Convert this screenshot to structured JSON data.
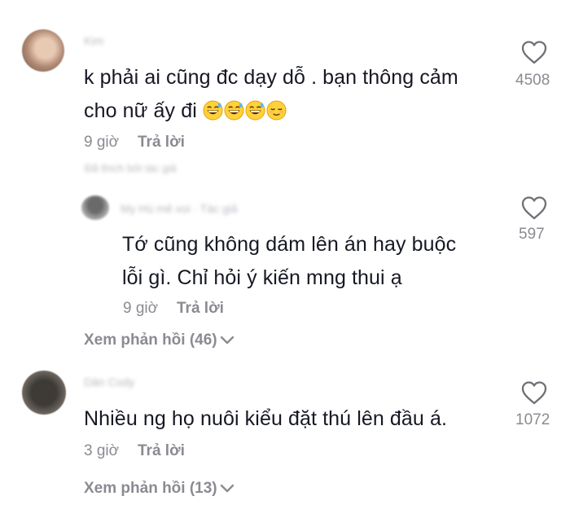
{
  "comments": [
    {
      "username": "Kim",
      "text_line1": "k phải ai cũng đc dạy dỗ . bạn thông cảm",
      "text_line2": "cho nữ ấy đi",
      "emojis": [
        "grinning-sweat-face",
        "grinning-sweat-face",
        "grinning-sweat-face",
        "relieved-face"
      ],
      "time": "9 giờ",
      "reply_label": "Trả lời",
      "liked_by_author": "Đã thích bởi tác giả",
      "like_count": "4508",
      "reply": {
        "username": "My Hú mê xoi",
        "author_tag": "· Tác giả",
        "text_line1": "Tớ cũng không dám lên án hay buộc",
        "text_line2": "lỗi gì. Chỉ hỏi ý kiến mng thui ạ",
        "time": "9 giờ",
        "reply_label": "Trả lời",
        "like_count": "597"
      },
      "view_replies": "Xem phản hồi (46)"
    },
    {
      "username": "Dân Cody",
      "text_line1": "Nhiều ng họ nuôi kiểu đặt thú lên đầu á.",
      "time": "3 giờ",
      "reply_label": "Trả lời",
      "like_count": "1072",
      "view_replies": "Xem phản hồi (13)"
    }
  ],
  "icons": {
    "close": "close-icon",
    "like": "heart-outline-icon",
    "expand": "chevron-down-icon"
  },
  "colors": {
    "text": "#161823",
    "muted": "#8a8b91",
    "author_tag": "#f06a7e"
  }
}
